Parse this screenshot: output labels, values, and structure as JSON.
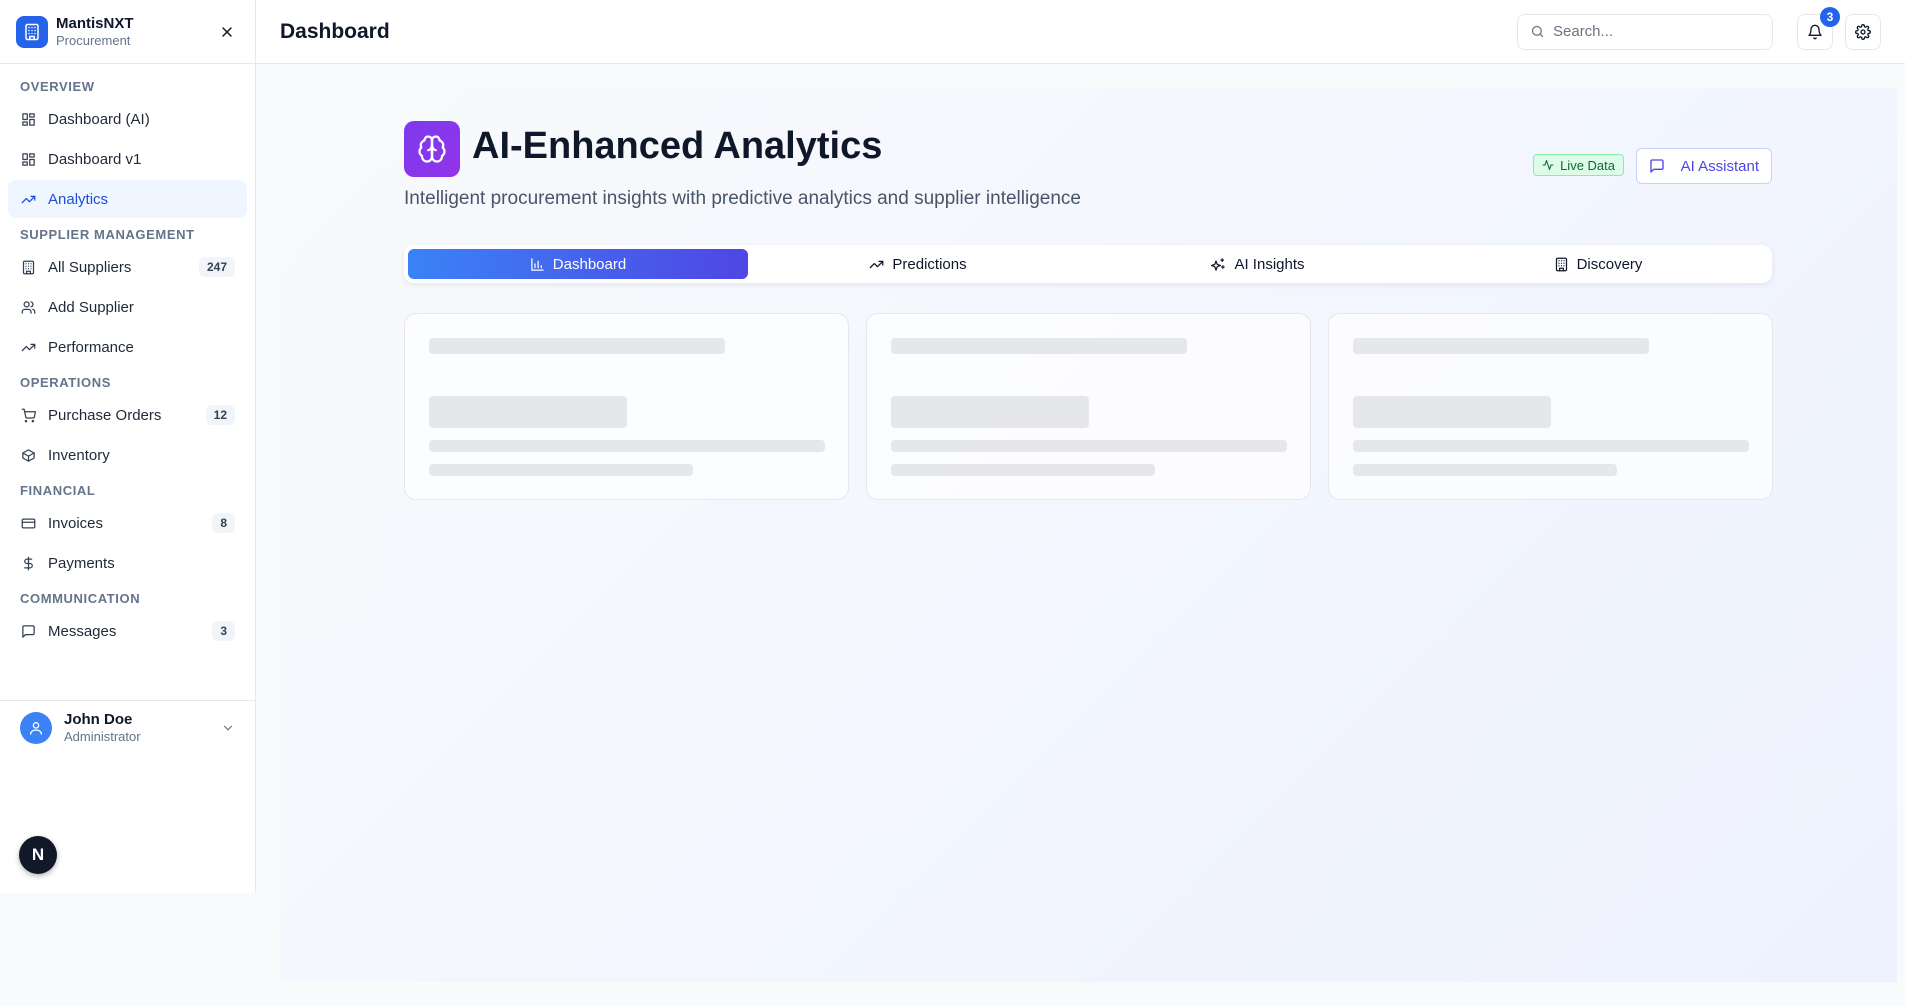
{
  "brand": {
    "name": "MantisNXT",
    "subtitle": "Procurement"
  },
  "sidebar": {
    "sections": [
      {
        "label": "OVERVIEW",
        "items": [
          {
            "label": "Dashboard (AI)",
            "icon": "grid-icon",
            "badge": "",
            "active": false
          },
          {
            "label": "Dashboard v1",
            "icon": "grid-icon",
            "badge": "",
            "active": false
          },
          {
            "label": "Analytics",
            "icon": "trending-up-icon",
            "badge": "",
            "active": true
          }
        ]
      },
      {
        "label": "SUPPLIER MANAGEMENT",
        "items": [
          {
            "label": "All Suppliers",
            "icon": "building-icon",
            "badge": "247",
            "active": false
          },
          {
            "label": "Add Supplier",
            "icon": "users-icon",
            "badge": "",
            "active": false
          },
          {
            "label": "Performance",
            "icon": "trending-up-icon",
            "badge": "",
            "active": false
          }
        ]
      },
      {
        "label": "OPERATIONS",
        "items": [
          {
            "label": "Purchase Orders",
            "icon": "cart-icon",
            "badge": "12",
            "active": false
          },
          {
            "label": "Inventory",
            "icon": "package-icon",
            "badge": "",
            "active": false
          }
        ]
      },
      {
        "label": "FINANCIAL",
        "items": [
          {
            "label": "Invoices",
            "icon": "credit-card-icon",
            "badge": "8",
            "active": false
          },
          {
            "label": "Payments",
            "icon": "dollar-icon",
            "badge": "",
            "active": false
          }
        ]
      },
      {
        "label": "COMMUNICATION",
        "items": [
          {
            "label": "Messages",
            "icon": "message-icon",
            "badge": "3",
            "active": false
          }
        ]
      }
    ]
  },
  "user": {
    "name": "John Doe",
    "role": "Administrator"
  },
  "next_badge": "N",
  "header": {
    "title": "Dashboard",
    "search_placeholder": "Search...",
    "notification_count": "3"
  },
  "hero": {
    "title": "AI-Enhanced Analytics",
    "subtitle": "Intelligent procurement insights with predictive analytics and supplier intelligence",
    "live_badge": "Live Data",
    "assistant_button": "AI Assistant"
  },
  "tabs": [
    {
      "label": "Dashboard",
      "icon": "bar-chart-icon",
      "active": true
    },
    {
      "label": "Predictions",
      "icon": "trending-up-icon",
      "active": false
    },
    {
      "label": "AI Insights",
      "icon": "sparkles-icon",
      "active": false
    },
    {
      "label": "Discovery",
      "icon": "building-icon",
      "active": false
    }
  ],
  "colors": {
    "accent": "#2563eb",
    "active_bg": "#eff6ff",
    "tab_gradient_start": "#3b82f6",
    "tab_gradient_end": "#4f46e5",
    "hero_icon": "#7c3aed",
    "live_green": "#166534"
  }
}
